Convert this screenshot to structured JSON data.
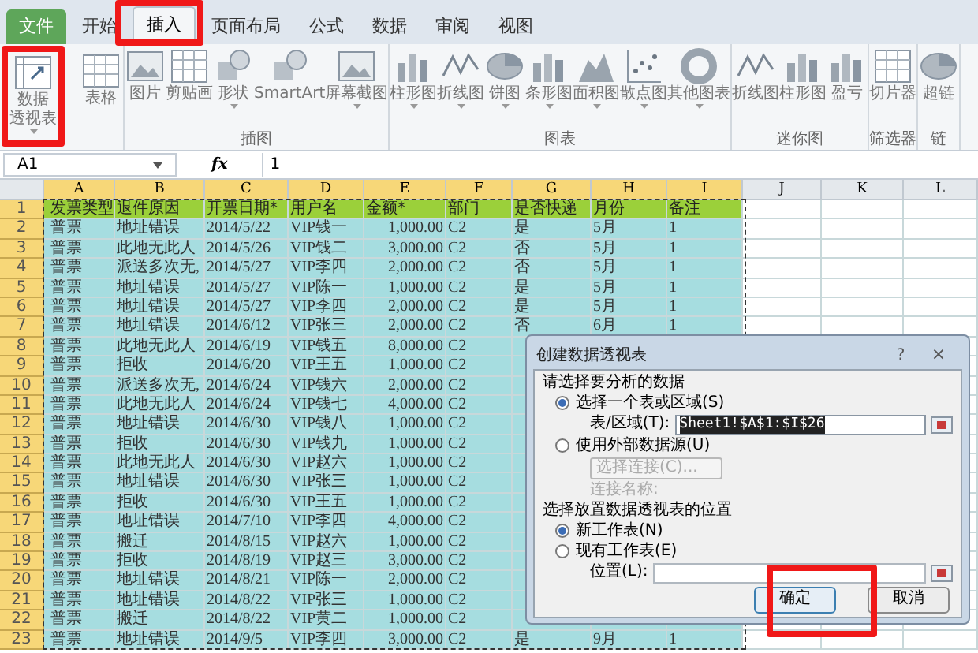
{
  "tabs": [
    {
      "label": "文件",
      "kind": "file",
      "selected": false
    },
    {
      "label": "开始",
      "kind": "tab",
      "selected": false
    },
    {
      "label": "插入",
      "kind": "tab",
      "selected": true
    },
    {
      "label": "页面布局",
      "kind": "tab",
      "selected": false
    },
    {
      "label": "公式",
      "kind": "tab",
      "selected": false
    },
    {
      "label": "数据",
      "kind": "tab",
      "selected": false
    },
    {
      "label": "审阅",
      "kind": "tab",
      "selected": false
    },
    {
      "label": "视图",
      "kind": "tab",
      "selected": false
    }
  ],
  "ribbon_groups": [
    {
      "buttons": [
        {
          "label": [
            "数据",
            "透视表"
          ],
          "kind": "pivot",
          "dropdown": true
        },
        {
          "label": [
            "表格"
          ],
          "kind": "grid",
          "dropdown": false
        }
      ]
    },
    {
      "label": "插图",
      "buttons": [
        {
          "label": [
            "图片"
          ],
          "kind": "image",
          "dropdown": false
        },
        {
          "label": [
            "剪贴画"
          ],
          "kind": "grid",
          "dropdown": false
        },
        {
          "label": [
            "形状"
          ],
          "kind": "shapes",
          "dropdown": true
        },
        {
          "label": [
            "SmartArt"
          ],
          "kind": "shapes",
          "dropdown": false
        },
        {
          "label": [
            "屏幕截图"
          ],
          "kind": "image",
          "dropdown": true
        }
      ]
    },
    {
      "label": "图表",
      "buttons": [
        {
          "label": [
            "柱形图"
          ],
          "kind": "bars",
          "dropdown": true
        },
        {
          "label": [
            "折线图"
          ],
          "kind": "line",
          "dropdown": true
        },
        {
          "label": [
            "饼图"
          ],
          "kind": "pie",
          "dropdown": true
        },
        {
          "label": [
            "条形图"
          ],
          "kind": "bars",
          "dropdown": true
        },
        {
          "label": [
            "面积图"
          ],
          "kind": "mountain",
          "dropdown": true
        },
        {
          "label": [
            "散点图"
          ],
          "kind": "scatter",
          "dropdown": true
        },
        {
          "label": [
            "其他图表"
          ],
          "kind": "donut",
          "dropdown": true
        }
      ]
    },
    {
      "label": "迷你图",
      "buttons": [
        {
          "label": [
            "折线图"
          ],
          "kind": "line",
          "dropdown": false
        },
        {
          "label": [
            "柱形图"
          ],
          "kind": "bars",
          "dropdown": false
        },
        {
          "label": [
            "盈亏"
          ],
          "kind": "bars",
          "dropdown": false
        }
      ]
    },
    {
      "label": "筛选器",
      "buttons": [
        {
          "label": [
            "切片器"
          ],
          "kind": "grid",
          "dropdown": false
        }
      ]
    },
    {
      "label": "链",
      "buttons": [
        {
          "label": [
            "超链"
          ],
          "kind": "pie",
          "dropdown": false
        }
      ]
    }
  ],
  "formula_bar": {
    "name_box": "A1",
    "fx": "fx",
    "value": "1"
  },
  "columns": [
    "A",
    "B",
    "C",
    "D",
    "E",
    "F",
    "G",
    "H",
    "I",
    "J",
    "K",
    "L"
  ],
  "rows": [
    {
      "num": "1",
      "kind": "header",
      "cells": [
        "发票类型",
        "退件原因",
        "开票日期*",
        "用户名",
        "金额*",
        "部门",
        "是否快递",
        "月份",
        "备注"
      ]
    },
    {
      "num": "2",
      "kind": "data",
      "cells": [
        "普票",
        "地址错误",
        "2014/5/22",
        "VIP钱一",
        "1,000.00",
        "C2",
        "是",
        "5月",
        "1"
      ]
    },
    {
      "num": "3",
      "kind": "data",
      "cells": [
        "普票",
        "此地无此人",
        "2014/5/26",
        "VIP钱二",
        "3,000.00",
        "C2",
        "否",
        "5月",
        "1"
      ]
    },
    {
      "num": "4",
      "kind": "data",
      "cells": [
        "普票",
        "派送多次无,",
        "2014/5/27",
        "VIP李四",
        "2,000.00",
        "C2",
        "否",
        "5月",
        "1"
      ]
    },
    {
      "num": "5",
      "kind": "data",
      "cells": [
        "普票",
        "地址错误",
        "2014/5/27",
        "VIP陈一",
        "1,000.00",
        "C2",
        "是",
        "5月",
        "1"
      ]
    },
    {
      "num": "6",
      "kind": "data",
      "cells": [
        "普票",
        "地址错误",
        "2014/5/27",
        "VIP李四",
        "2,000.00",
        "C2",
        "是",
        "5月",
        "1"
      ]
    },
    {
      "num": "7",
      "kind": "data",
      "cells": [
        "普票",
        "地址错误",
        "2014/6/12",
        "VIP张三",
        "2,000.00",
        "C2",
        "否",
        "6月",
        "1"
      ]
    },
    {
      "num": "8",
      "kind": "data",
      "cells": [
        "普票",
        "此地无此人",
        "2014/6/19",
        "VIP钱五",
        "8,000.00",
        "C2"
      ]
    },
    {
      "num": "9",
      "kind": "data",
      "cells": [
        "普票",
        "拒收",
        "2014/6/20",
        "VIP王五",
        "1,000.00",
        "C2"
      ]
    },
    {
      "num": "10",
      "kind": "data",
      "cells": [
        "普票",
        "派送多次无,",
        "2014/6/24",
        "VIP钱六",
        "2,000.00",
        "C2"
      ]
    },
    {
      "num": "11",
      "kind": "data",
      "cells": [
        "普票",
        "此地无此人",
        "2014/6/24",
        "VIP钱七",
        "4,000.00",
        "C2"
      ]
    },
    {
      "num": "12",
      "kind": "data",
      "cells": [
        "普票",
        "地址错误",
        "2014/6/30",
        "VIP钱八",
        "1,000.00",
        "C2"
      ]
    },
    {
      "num": "13",
      "kind": "data",
      "cells": [
        "普票",
        "拒收",
        "2014/6/30",
        "VIP钱九",
        "1,000.00",
        "C2"
      ]
    },
    {
      "num": "14",
      "kind": "data",
      "cells": [
        "普票",
        "此地无此人",
        "2014/6/30",
        "VIP赵六",
        "1,000.00",
        "C2"
      ]
    },
    {
      "num": "15",
      "kind": "data",
      "cells": [
        "普票",
        "地址错误",
        "2014/6/30",
        "VIP张三",
        "1,000.00",
        "C2"
      ]
    },
    {
      "num": "16",
      "kind": "data",
      "cells": [
        "普票",
        "拒收",
        "2014/6/30",
        "VIP王五",
        "1,000.00",
        "C2"
      ]
    },
    {
      "num": "17",
      "kind": "data",
      "cells": [
        "普票",
        "地址错误",
        "2014/7/10",
        "VIP李四",
        "4,000.00",
        "C2"
      ]
    },
    {
      "num": "18",
      "kind": "data",
      "cells": [
        "普票",
        "搬迁",
        "2014/8/15",
        "VIP赵六",
        "1,000.00",
        "C2"
      ]
    },
    {
      "num": "19",
      "kind": "data",
      "cells": [
        "普票",
        "拒收",
        "2014/8/19",
        "VIP赵三",
        "3,000.00",
        "C2"
      ]
    },
    {
      "num": "20",
      "kind": "data",
      "cells": [
        "普票",
        "地址错误",
        "2014/8/21",
        "VIP陈一",
        "2,000.00",
        "C2"
      ]
    },
    {
      "num": "21",
      "kind": "data",
      "cells": [
        "普票",
        "地址错误",
        "2014/8/22",
        "VIP张三",
        "1,000.00",
        "C2"
      ]
    },
    {
      "num": "22",
      "kind": "data",
      "cells": [
        "普票",
        "搬迁",
        "2014/8/22",
        "VIP黄二",
        "1,000.00",
        "C2"
      ]
    },
    {
      "num": "23",
      "kind": "data",
      "cells": [
        "普票",
        "地址错误",
        "2014/9/5",
        "VIP李四",
        "3,000.00",
        "C2",
        "是",
        "9月",
        "1"
      ]
    }
  ],
  "dialog": {
    "title": "创建数据透视表",
    "help": "?",
    "close": "×",
    "section_1": "请选择要分析的数据",
    "option_range": {
      "label": "选择一个表或区域(S)",
      "selected": true
    },
    "range_label": "表/区域(T):",
    "range_value": "Sheet1!$A$1:$I$26",
    "option_external": {
      "label": "使用外部数据源(U)",
      "selected": false
    },
    "connect_button": {
      "label": "选择连接(C)...",
      "disabled": true
    },
    "connection_name": "连接名称:",
    "section_2": "选择放置数据透视表的位置",
    "option_new": {
      "label": "新工作表(N)",
      "selected": true
    },
    "option_existing": {
      "label": "现有工作表(E)",
      "selected": false
    },
    "location_label": "位置(L):",
    "ok": "确定",
    "cancel": "取消"
  }
}
